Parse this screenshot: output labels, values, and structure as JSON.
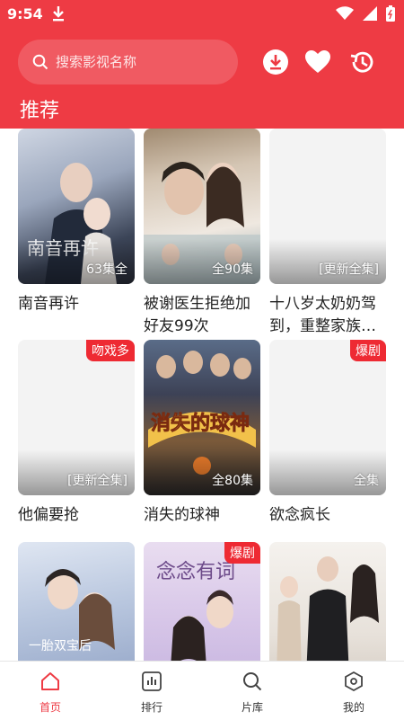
{
  "status_bar": {
    "time": "9:54"
  },
  "header": {
    "search_placeholder": "搜索影视名称",
    "title": "推荐"
  },
  "colors": {
    "brand": "#ee3b44",
    "tag": "#ee2a33"
  },
  "cards": [
    {
      "title": "南音再许",
      "status": "63集全",
      "tag": ""
    },
    {
      "title": "被谢医生拒绝加好友99次",
      "status": "全90集",
      "tag": ""
    },
    {
      "title": "十八岁太奶奶驾到，重整家族荣耀",
      "status": "[更新全集]",
      "tag": ""
    },
    {
      "title": "他偏要抢",
      "status": "[更新全集]",
      "tag": "吻戏多"
    },
    {
      "title": "消失的球神",
      "status": "全80集",
      "tag": ""
    },
    {
      "title": "欲念疯长",
      "status": "全集",
      "tag": "爆剧"
    },
    {
      "title": "",
      "status": "",
      "tag": ""
    },
    {
      "title": "",
      "status": "",
      "tag": "爆剧"
    },
    {
      "title": "",
      "status": "",
      "tag": ""
    }
  ],
  "bottom_nav": [
    {
      "label": "首页",
      "icon": "home-icon"
    },
    {
      "label": "排行",
      "icon": "ranking-icon"
    },
    {
      "label": "片库",
      "icon": "search-icon"
    },
    {
      "label": "我的",
      "icon": "profile-icon"
    }
  ]
}
